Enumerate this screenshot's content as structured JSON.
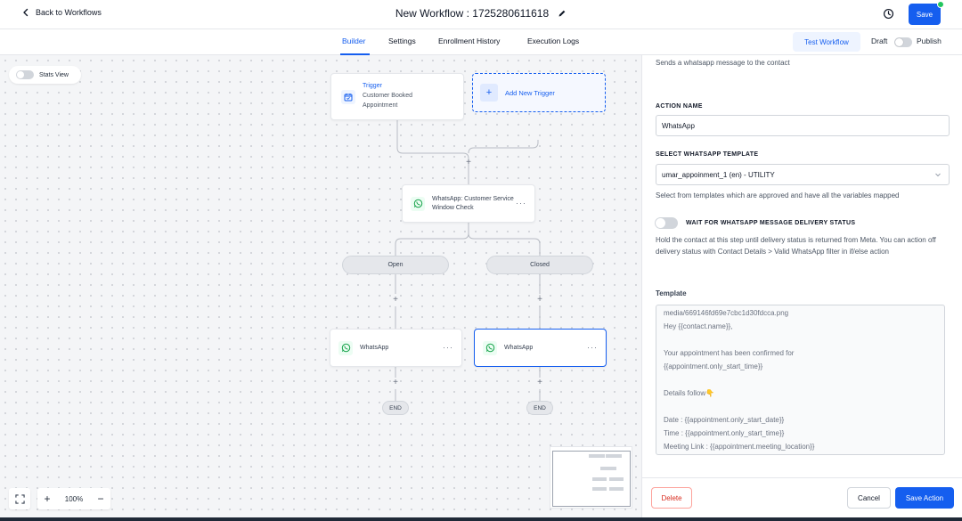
{
  "header": {
    "back_label": "Back to Workflows",
    "title": "New Workflow : 1725280611618",
    "save_label": "Save"
  },
  "tabs": [
    {
      "label": "Builder",
      "active": true
    },
    {
      "label": "Settings",
      "active": false
    },
    {
      "label": "Enrollment History",
      "active": false
    },
    {
      "label": "Execution Logs",
      "active": false
    }
  ],
  "toolbar": {
    "test_workflow_label": "Test Workflow",
    "draft_label": "Draft",
    "publish_label": "Publish"
  },
  "canvas": {
    "stats_view_label": "Stats View",
    "trigger": {
      "title": "Trigger",
      "subtitle": "Customer Booked Appointment"
    },
    "add_trigger_label": "Add New Trigger",
    "check_node_label": "WhatsApp: Customer Service Window Check",
    "branches": [
      {
        "label": "Open",
        "action_label": "WhatsApp",
        "end_label": "END"
      },
      {
        "label": "Closed",
        "action_label": "WhatsApp",
        "end_label": "END"
      }
    ],
    "zoom_level": "100%",
    "icons": {
      "trigger": "calendar-icon",
      "whatsapp": "whatsapp-icon",
      "fullscreen": "fullscreen-icon"
    }
  },
  "panel": {
    "description": "Sends a whatsapp message to the contact",
    "action_name_label": "ACTION NAME",
    "action_name_value": "WhatsApp",
    "template_select_label": "SELECT WHATSAPP TEMPLATE",
    "template_select_value": "umar_appoinment_1 (en) - UTILITY",
    "template_select_help": "Select from templates which are approved and have all the variables mapped",
    "wait_label": "WAIT FOR WHATSAPP MESSAGE DELIVERY STATUS",
    "wait_help": "Hold the contact at this step until delivery status is returned from Meta. You can action off delivery status with Contact Details > Valid WhatsApp filter in if/else action",
    "template_label": "Template",
    "template_lines": [
      "media/669146fd69e7cbc1d30fdcca.png",
      "Hey {{contact.name}},",
      "",
      "Your appointment has been confirmed for",
      "{{appointment.only_start_time}}",
      "",
      "Details follow👇",
      "",
      "Date : {{appointment.only_start_date}}",
      "Time : {{appointment.only_start_time}}",
      "Meeting Link : {{appointment.meeting_location}}"
    ],
    "delete_label": "Delete",
    "cancel_label": "Cancel",
    "save_action_label": "Save Action"
  },
  "colors": {
    "accent": "#155eef",
    "danger": "#d92d20",
    "whatsapp": "#25d366",
    "status_dot": "#22c55e"
  }
}
